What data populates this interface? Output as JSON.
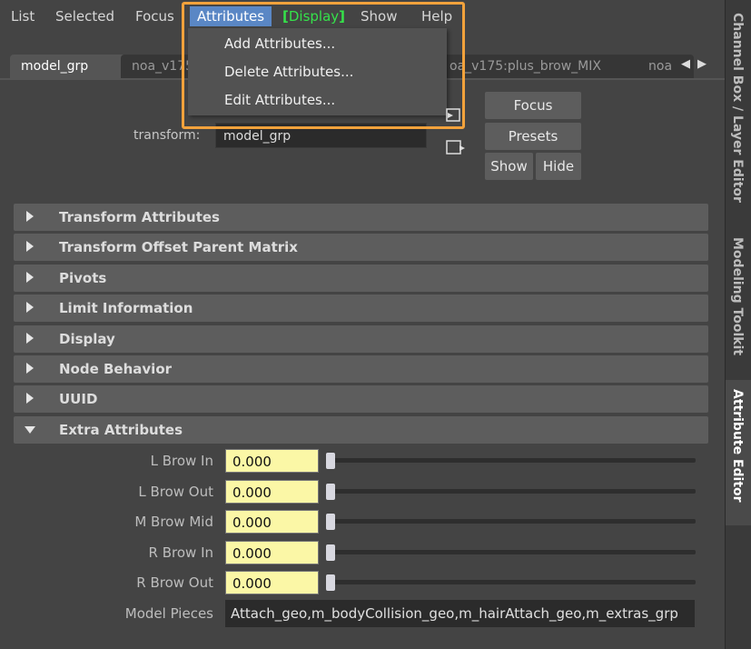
{
  "menubar": {
    "items": [
      {
        "label": "List"
      },
      {
        "label": "Selected"
      },
      {
        "label": "Focus"
      },
      {
        "label": "Attributes"
      },
      {
        "label": "Display"
      },
      {
        "label": "Show"
      },
      {
        "label": "Help"
      }
    ]
  },
  "attributes_menu": {
    "items": [
      {
        "label": "Add Attributes..."
      },
      {
        "label": "Delete Attributes..."
      },
      {
        "label": "Edit Attributes..."
      }
    ]
  },
  "tabs": [
    {
      "label": "model_grp"
    },
    {
      "label": "noa_v175"
    },
    {
      "label": "oa_v175:plus_brow_MIX"
    },
    {
      "label": "noa"
    }
  ],
  "node": {
    "type_label": "transform:",
    "name": "model_grp"
  },
  "buttons": {
    "focus": "Focus",
    "presets": "Presets",
    "show": "Show",
    "hide": "Hide"
  },
  "sections": [
    {
      "label": "Transform Attributes",
      "expanded": false
    },
    {
      "label": "Transform Offset Parent Matrix",
      "expanded": false
    },
    {
      "label": "Pivots",
      "expanded": false
    },
    {
      "label": "Limit Information",
      "expanded": false
    },
    {
      "label": "Display",
      "expanded": false
    },
    {
      "label": "Node Behavior",
      "expanded": false
    },
    {
      "label": "UUID",
      "expanded": false
    },
    {
      "label": "Extra Attributes",
      "expanded": true
    }
  ],
  "extra_attributes": [
    {
      "label": "L Brow In",
      "value": "0.000"
    },
    {
      "label": "L Brow Out",
      "value": "0.000"
    },
    {
      "label": "M Brow Mid",
      "value": "0.000"
    },
    {
      "label": "R Brow In",
      "value": "0.000"
    },
    {
      "label": "R Brow Out",
      "value": "0.000"
    }
  ],
  "model_pieces": {
    "label": "Model Pieces",
    "value": "Attach_geo,m_bodyCollision_geo,m_hairAttach_geo,m_extras_grp"
  },
  "side_tabs": [
    {
      "label": "Channel Box / Layer Editor"
    },
    {
      "label": "Modeling Toolkit"
    },
    {
      "label": "Attribute Editor"
    }
  ],
  "colors": {
    "menu_active": "#5a87c5",
    "display_green": "#35e24a",
    "highlight_border": "#f2a23c",
    "field_yellow": "#fbf7a6"
  }
}
